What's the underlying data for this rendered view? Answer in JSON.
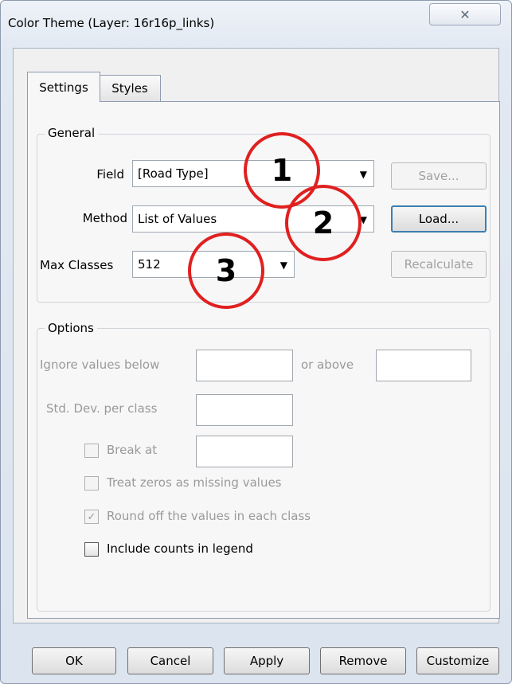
{
  "window": {
    "title": "Color Theme (Layer: 16r16p_links)",
    "close_icon": "close-icon"
  },
  "tabs": [
    {
      "label": "Settings",
      "selected": true
    },
    {
      "label": "Styles",
      "selected": false
    }
  ],
  "general": {
    "title": "General",
    "field": {
      "label": "Field",
      "value": "[Road Type]"
    },
    "method": {
      "label": "Method",
      "value": "List of Values"
    },
    "max_classes": {
      "label": "Max Classes",
      "value": "512"
    },
    "save_label": "Save...",
    "load_label": "Load...",
    "recalculate_label": "Recalculate"
  },
  "options": {
    "title": "Options",
    "ignore_below_label": "Ignore values below",
    "or_above_label": "or above",
    "std_dev_label": "Std. Dev. per class",
    "break_at_label": "Break at",
    "treat_zeros_label": "Treat zeros as missing values",
    "round_off_label": "Round off the values in each class",
    "include_counts_label": "Include counts in legend",
    "round_off_checked": true,
    "include_counts_checked": false
  },
  "callouts": [
    "1",
    "2",
    "3"
  ],
  "footer": {
    "ok": "OK",
    "cancel": "Cancel",
    "apply": "Apply",
    "remove": "Remove",
    "customize": "Customize"
  },
  "colors": {
    "callout_ring": "#e02020",
    "accent_border": "#3c7fb1"
  }
}
